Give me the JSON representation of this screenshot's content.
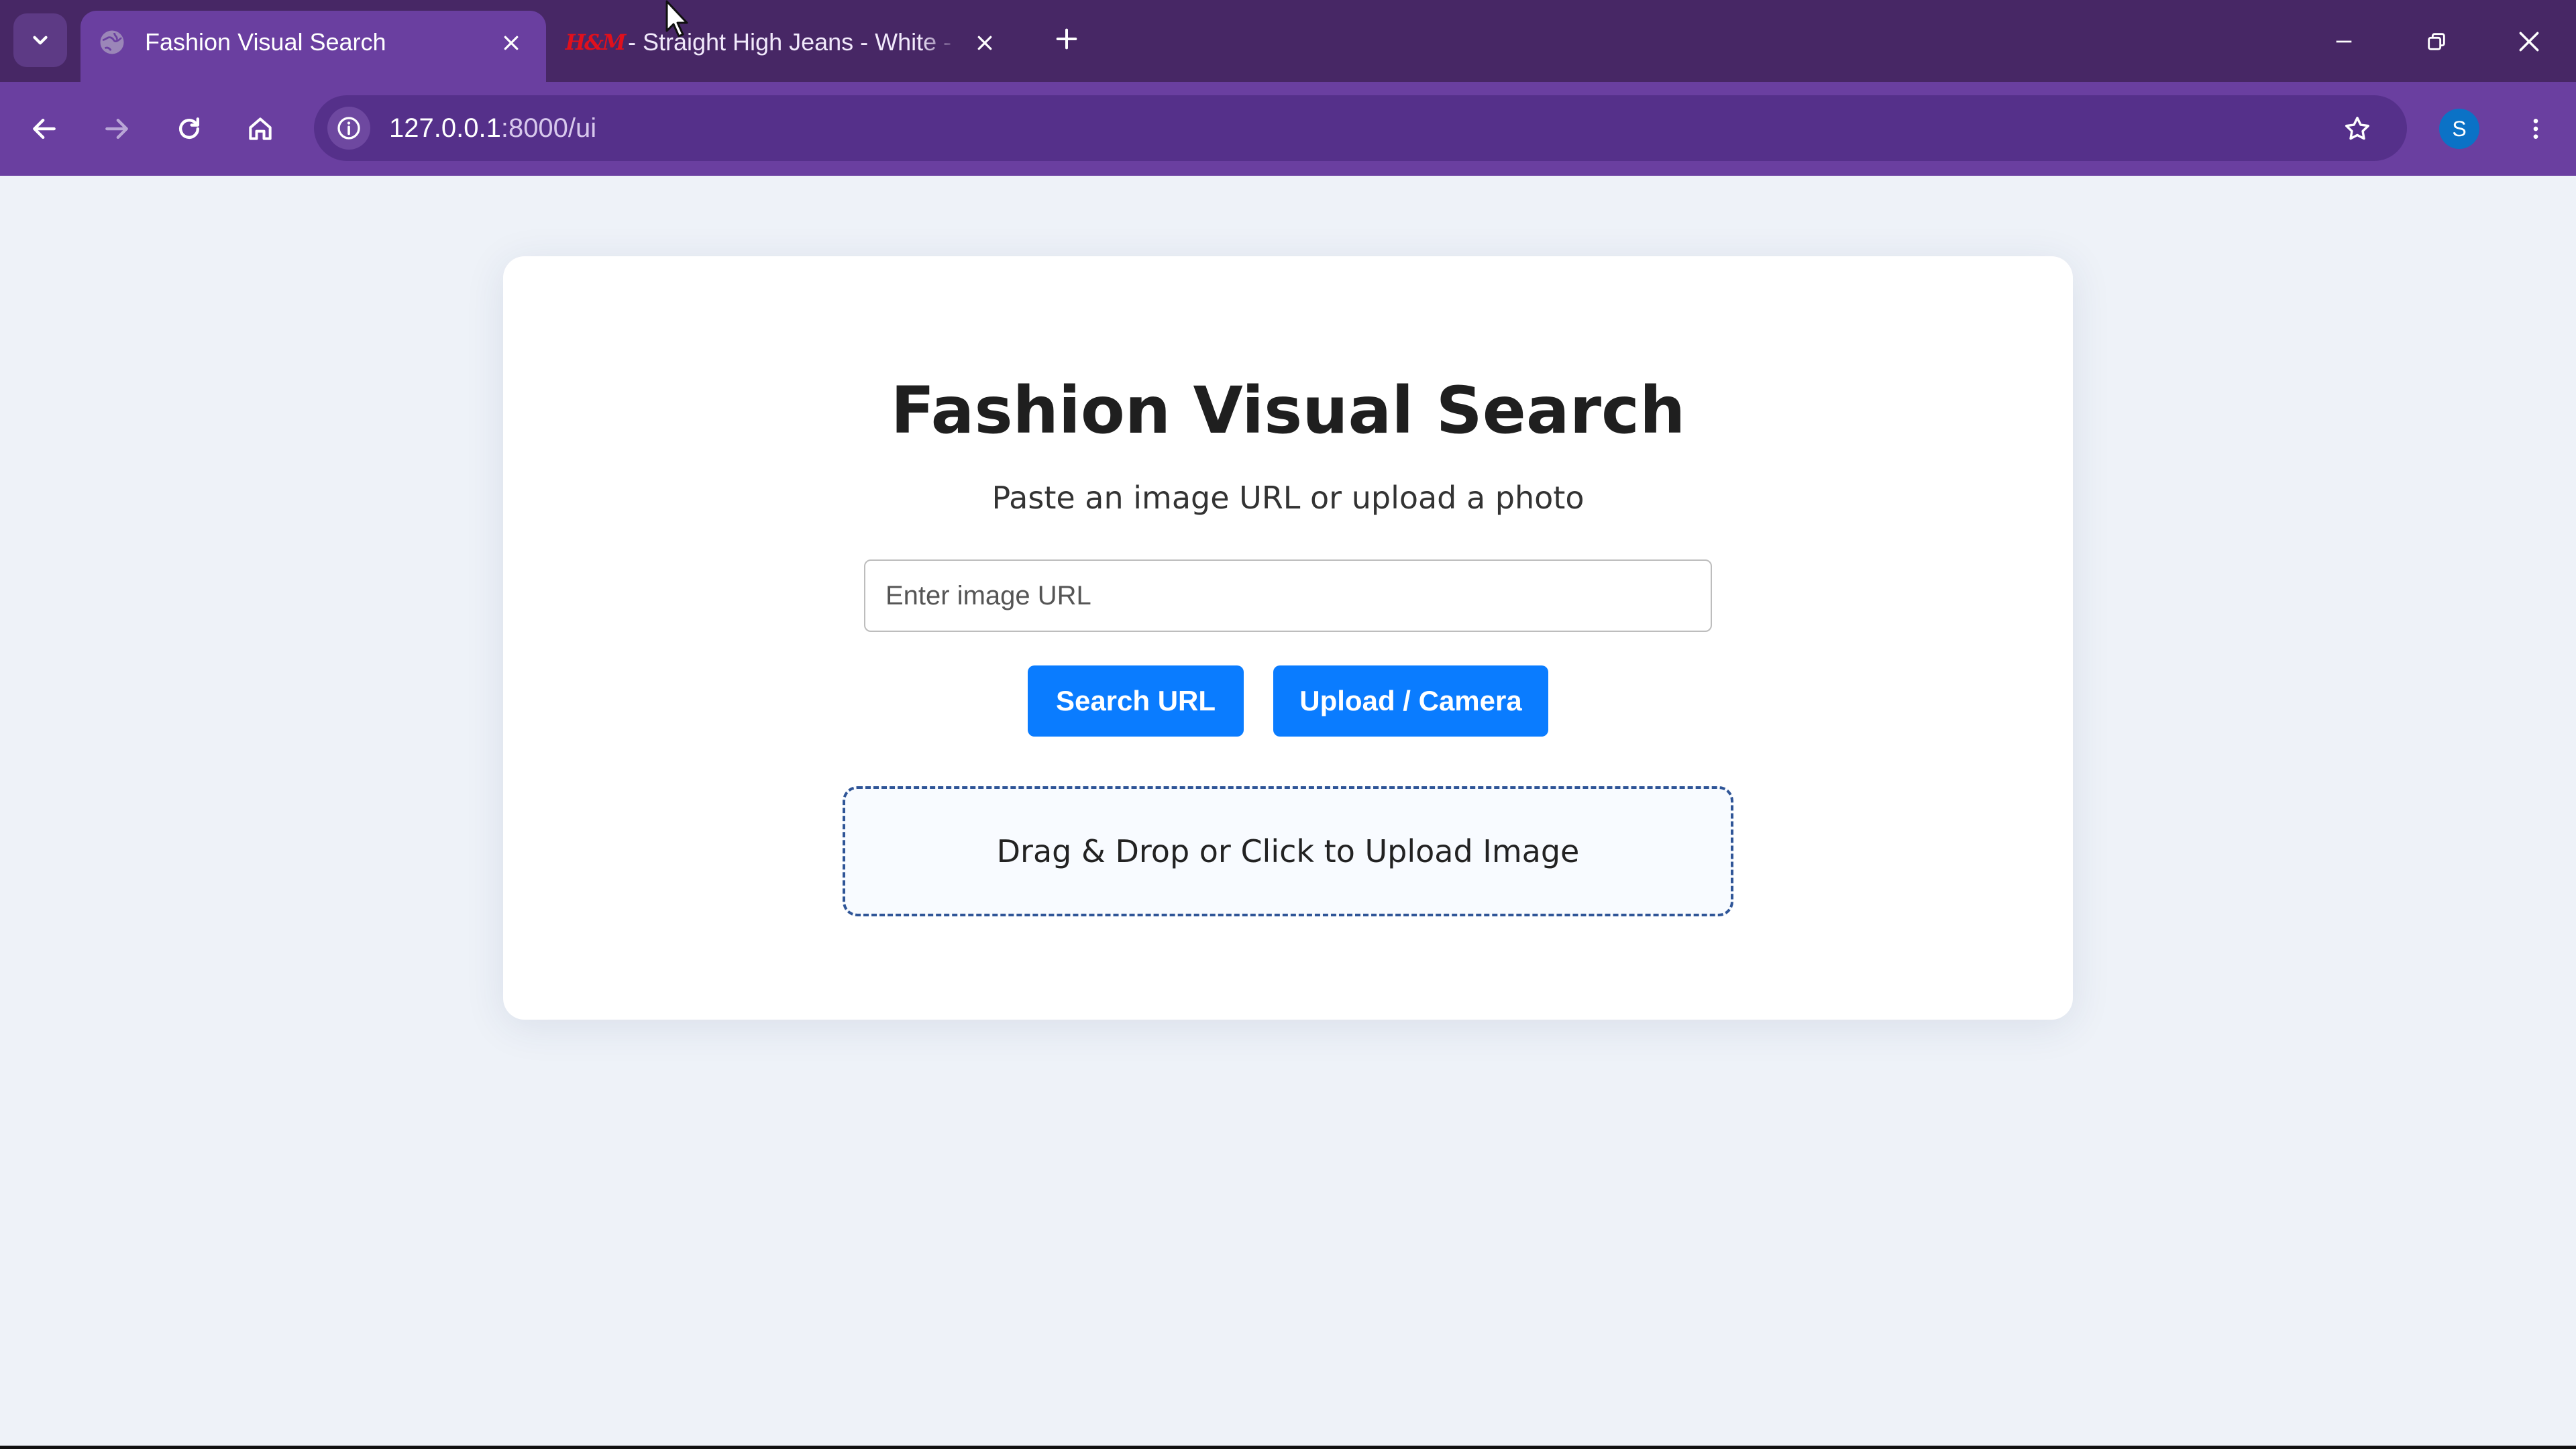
{
  "browser": {
    "tabs": [
      {
        "title": "Fashion Visual Search",
        "favicon": "globe-icon",
        "active": true
      },
      {
        "title": "- Straight High Jeans - White - H&M",
        "favicon": "hm-logo",
        "favicon_text": "H&M",
        "active": false
      }
    ],
    "address_bar": {
      "host": "127.0.0.1",
      "path": ":8000/ui"
    },
    "profile_initial": "S",
    "colors": {
      "tabstrip": "#472765",
      "toolbar": "#6a3fa0",
      "omnibox": "#55308a",
      "avatar": "#0b72c6"
    }
  },
  "page": {
    "title": "Fashion Visual Search",
    "subtitle": "Paste an image URL or upload a photo",
    "url_input": {
      "placeholder": "Enter image URL",
      "value": ""
    },
    "buttons": {
      "search_url": "Search URL",
      "upload_camera": "Upload / Camera"
    },
    "dropzone_label": "Drag & Drop or Click to Upload Image",
    "colors": {
      "background": "#eef2f8",
      "card": "#ffffff",
      "button": "#0a7cff",
      "dropzone_border": "#2f5597"
    }
  }
}
